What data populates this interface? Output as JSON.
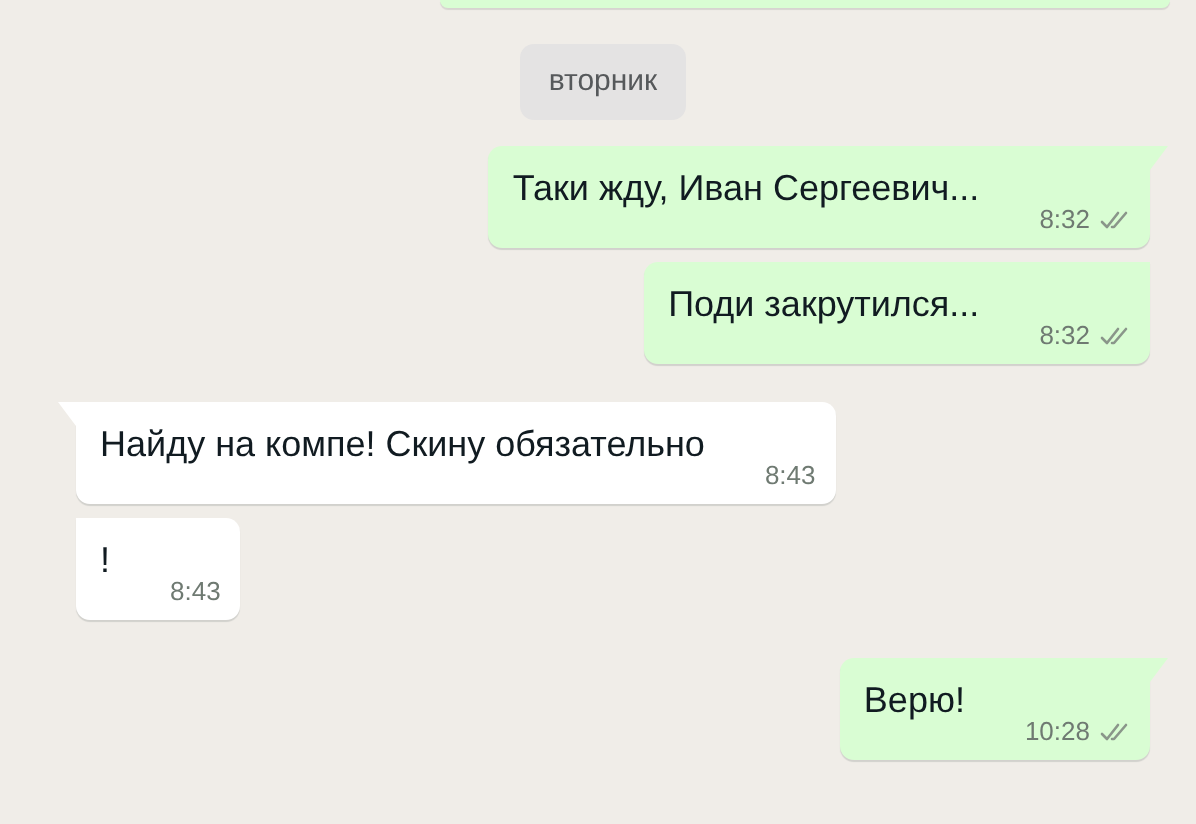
{
  "cut_bubble": {
    "kind": "outgoing"
  },
  "date_chip": "вторник",
  "messages": [
    {
      "kind": "outgoing",
      "text": "Таки жду, Иван Сергеевич...",
      "time": "8:32",
      "read": true,
      "tail": true
    },
    {
      "kind": "outgoing",
      "text": "Поди закрутился...",
      "time": "8:32",
      "read": true,
      "tail": false
    },
    {
      "kind": "incoming",
      "text": "Найду на компе! Скину обязательно",
      "time": "8:43",
      "tail": true
    },
    {
      "kind": "incoming",
      "text": "!",
      "time": "8:43",
      "tail": false
    },
    {
      "kind": "outgoing",
      "text": "Верю!",
      "time": "10:28",
      "read": true,
      "tail": true
    }
  ]
}
